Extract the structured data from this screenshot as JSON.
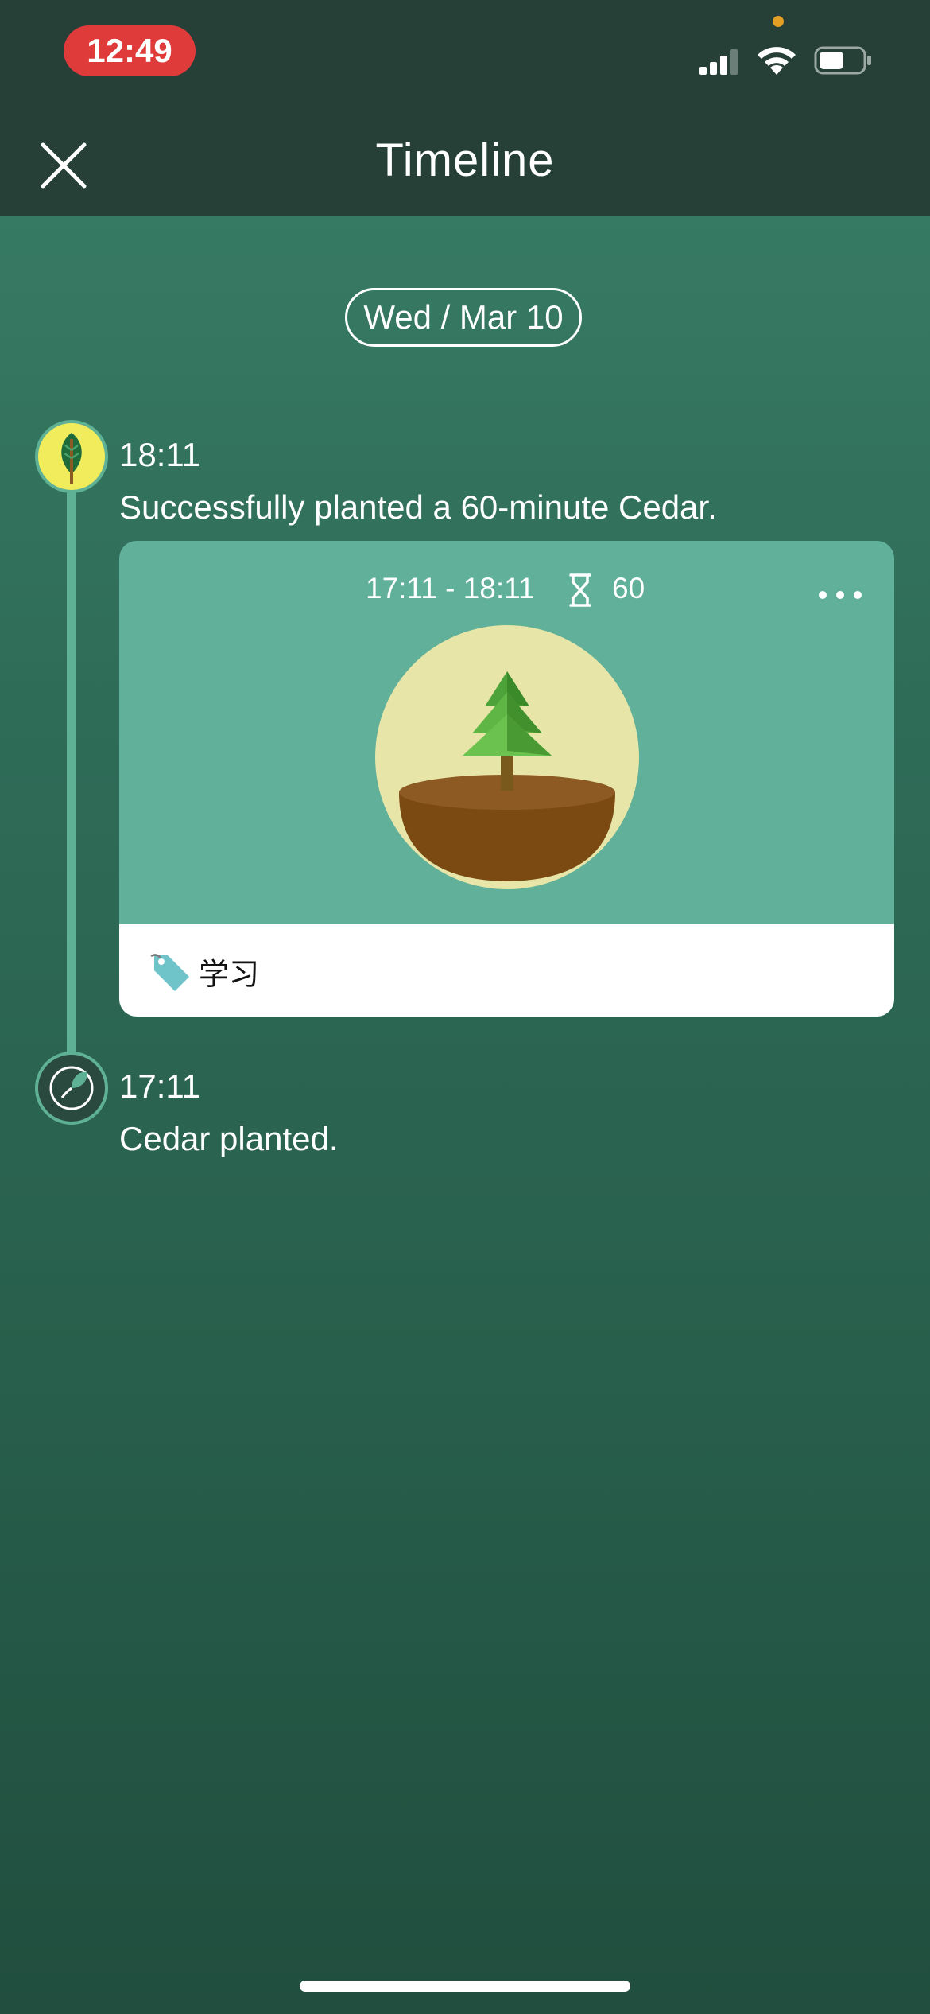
{
  "status_bar": {
    "time": "12:49"
  },
  "nav": {
    "title": "Timeline"
  },
  "date_label": "Wed / Mar 10",
  "entries": [
    {
      "time": "18:11",
      "text": "Successfully planted a 60-minute Cedar.",
      "card": {
        "range": "17:11 - 18:11",
        "minutes": "60",
        "tag": "学习",
        "tree_icon": "cedar-tree-icon",
        "tag_icon": "tag-icon"
      }
    },
    {
      "time": "17:11",
      "text": "Cedar planted."
    }
  ],
  "colors": {
    "header_bg": "#263f37",
    "accent": "#5fb196",
    "card_bg": "#61b09a",
    "status_time_pill": "#e03b3b",
    "node_done": "#f1ec5b"
  }
}
